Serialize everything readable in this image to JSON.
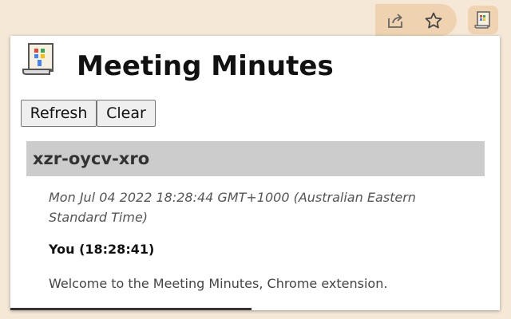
{
  "browser": {
    "icons": [
      "share-icon",
      "star-icon",
      "meeting-minutes-extension-icon"
    ]
  },
  "popup": {
    "title": "Meeting Minutes",
    "buttons": {
      "refresh_label": "Refresh",
      "clear_label": "Clear"
    },
    "meeting": {
      "code": "xzr-oycv-xro",
      "date": "Mon Jul 04 2022 18:28:44 GMT+1000 (Australian Eastern Standard Time)",
      "entries": [
        {
          "speaker": "You (18:28:41)",
          "text": "Welcome to the Meeting Minutes, Chrome extension."
        }
      ]
    }
  },
  "colors": {
    "toolbar_bg": "#f5e8d6",
    "omnibox_bg": "#efd3b0",
    "header_bg": "#cccccc"
  }
}
